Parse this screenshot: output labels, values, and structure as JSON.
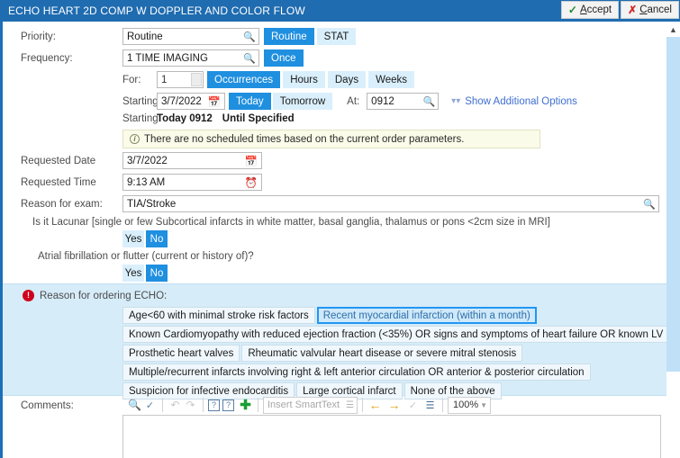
{
  "window": {
    "title": "ECHO HEART 2D COMP W DOPPLER AND COLOR FLOW",
    "accept_label": "Accept",
    "accept_accesskey": "A",
    "cancel_label": "Cancel",
    "cancel_accesskey": "C",
    "accent_color": "#1f6cb0",
    "selected_button_color": "#1f8fe0",
    "segment_bg_color": "#daeffc"
  },
  "form": {
    "priority": {
      "label": "Priority:",
      "value": "Routine",
      "placeholder": "",
      "options": [
        "Routine",
        "STAT"
      ],
      "selected": "Routine"
    },
    "frequency": {
      "label": "Frequency:",
      "value": "1 TIME IMAGING",
      "options": [
        "Once"
      ],
      "selected": "Once"
    },
    "for": {
      "label": "For:",
      "value": "1",
      "units": [
        "Occurrences",
        "Hours",
        "Days",
        "Weeks"
      ],
      "selected_unit": "Occurrences"
    },
    "starting": {
      "label": "Starting:",
      "date_value": "3/7/2022",
      "quick_options": [
        "Today",
        "Tomorrow"
      ],
      "selected_quick": "Today",
      "at_label": "At:",
      "time_value": "0912",
      "additional_options_link": "Show Additional Options"
    },
    "starting_summary": {
      "label": "Starting:",
      "value": "Today 0912",
      "until": "Until Specified"
    },
    "schedule_banner": {
      "icon": "info-icon",
      "text": "There are no scheduled times based on the current order parameters."
    },
    "requested_date": {
      "label": "Requested Date",
      "value": "3/7/2022"
    },
    "requested_time": {
      "label": "Requested Time",
      "value": "9:13 AM"
    },
    "reason_for_exam": {
      "label": "Reason for exam:",
      "value": "TIA/Stroke"
    }
  },
  "questions": [
    {
      "text": "Is it Lacunar [single or few Subcortical infarcts in white matter, basal ganglia, thalamus or pons <2cm size in MRI]",
      "yes_label": "Yes",
      "no_label": "No",
      "selected": "No"
    },
    {
      "text": "Atrial fibrillation or flutter (current or history of)?",
      "yes_label": "Yes",
      "no_label": "No",
      "selected": "No"
    }
  ],
  "echo_reason": {
    "error_icon": "error-icon",
    "label": "Reason for ordering ECHO:",
    "background_color": "#d6ecf9",
    "selected": "Recent myocardial infarction (within a month)",
    "rows": [
      [
        "Age<60 with minimal stroke risk factors",
        "Recent myocardial infarction (within a month)"
      ],
      [
        "Known Cardiomyopathy with reduced ejection fraction (<35%) OR signs and symptoms of heart failure OR known LV aneurysm"
      ],
      [
        "Prosthetic heart valves",
        "Rheumatic valvular heart disease or severe mitral stenosis"
      ],
      [
        "Multiple/recurrent infarcts involving right & left anterior circulation OR anterior & posterior circulation"
      ],
      [
        "Suspicion for infective endocarditis",
        "Large cortical infarct",
        "None of the above"
      ]
    ]
  },
  "comments": {
    "label": "Comments:",
    "value": "",
    "toolbar": {
      "icons": [
        "zoom-in-icon",
        "spell-check-icon",
        "undo-icon",
        "redo-icon",
        "help-question-icon",
        "help-info-icon",
        "add-icon",
        "back-arrow-icon",
        "forward-arrow-icon",
        "accept-check-icon",
        "list-icon"
      ],
      "smarttext_placeholder": "Insert SmartText",
      "zoom_value": "100%"
    }
  }
}
